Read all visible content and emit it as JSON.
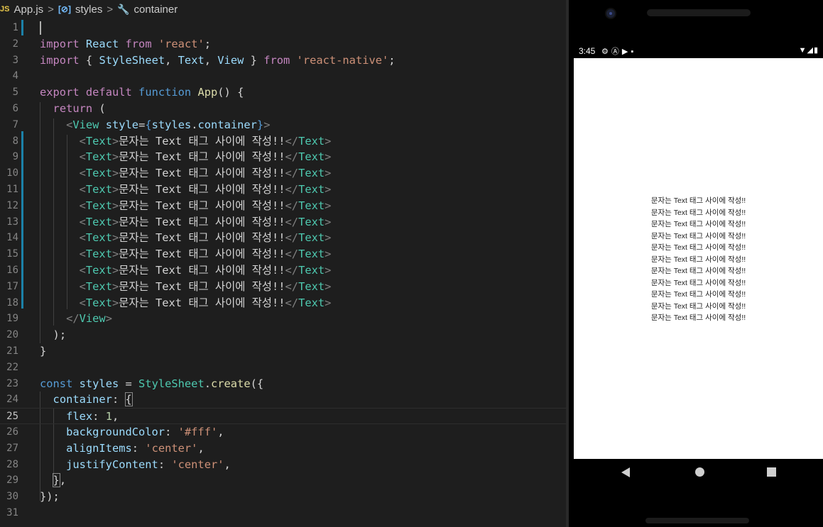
{
  "breadcrumb": {
    "file_icon": "JS",
    "file": "App.js",
    "separator": ">",
    "symbol_icon": "[⊘]",
    "symbol": "styles",
    "member_icon": "wrench-icon",
    "member": "container"
  },
  "editor": {
    "line_numbers": [
      "1",
      "2",
      "3",
      "4",
      "5",
      "6",
      "7",
      "8",
      "9",
      "10",
      "11",
      "12",
      "13",
      "14",
      "15",
      "16",
      "17",
      "18",
      "19",
      "20",
      "21",
      "22",
      "23",
      "24",
      "25",
      "26",
      "27",
      "28",
      "29",
      "30",
      "31"
    ],
    "code": {
      "l2": {
        "kw1": "import",
        "id": "React",
        "kw2": "from",
        "str": "'react'",
        "end": ";"
      },
      "l3": {
        "kw1": "import",
        "open": "{ ",
        "a": "StyleSheet",
        "c1": ", ",
        "b": "Text",
        "c2": ", ",
        "c": "View",
        "close": " }",
        "kw2": "from",
        "str": "'react-native'",
        "end": ";"
      },
      "l5": {
        "kw1": "export",
        "kw2": "default",
        "kw3": "function",
        "fn": "App",
        "rest": "() {"
      },
      "l6": {
        "kw": "return",
        "rest": " ("
      },
      "l7": {
        "lt": "<",
        "tag": "View",
        "attr": "style",
        "eq": "=",
        "ob": "{",
        "obj": "styles",
        "dot": ".",
        "prop": "container",
        "cb": "}",
        "gt": ">"
      },
      "text_line": {
        "open_lt": "<",
        "open_tag": "Text",
        "open_gt": ">",
        "content": "문자는 Text 태그 사이에 작성!!",
        "close_lt": "</",
        "close_tag": "Text",
        "close_gt": ">"
      },
      "l19": {
        "lt": "</",
        "tag": "View",
        "gt": ">"
      },
      "l20": {
        "text": ");"
      },
      "l21": {
        "text": "}"
      },
      "l23": {
        "kw": "const",
        "id": "styles",
        "eq": " = ",
        "cls": "StyleSheet",
        "dot": ".",
        "fn": "create",
        "rest": "({"
      },
      "l24": {
        "prop": "container",
        "colon": ": ",
        "brace": "{"
      },
      "l25": {
        "prop": "flex",
        "colon": ": ",
        "num": "1",
        "end": ","
      },
      "l26": {
        "prop": "backgroundColor",
        "colon": ": ",
        "str": "'#fff'",
        "end": ","
      },
      "l27": {
        "prop": "alignItems",
        "colon": ": ",
        "str": "'center'",
        "end": ","
      },
      "l28": {
        "prop": "justifyContent",
        "colon": ": ",
        "str": "'center'",
        "end": ","
      },
      "l29": {
        "brace": "}",
        "end": ","
      },
      "l30": {
        "text": "});"
      }
    }
  },
  "emulator": {
    "status_time": "3:45",
    "status_icons": [
      "gear-icon",
      "a-icon",
      "play-icon",
      "sd-card-icon"
    ],
    "status_right_icons": [
      "wifi-icon",
      "signal-icon",
      "battery-icon"
    ],
    "rendered_texts": [
      "문자는 Text 태그 사이에 작성!!",
      "문자는 Text 태그 사이에 작성!!",
      "문자는 Text 태그 사이에 작성!!",
      "문자는 Text 태그 사이에 작성!!",
      "문자는 Text 태그 사이에 작성!!",
      "문자는 Text 태그 사이에 작성!!",
      "문자는 Text 태그 사이에 작성!!",
      "문자는 Text 태그 사이에 작성!!",
      "문자는 Text 태그 사이에 작성!!",
      "문자는 Text 태그 사이에 작성!!",
      "문자는 Text 태그 사이에 작성!!"
    ],
    "nav_buttons": [
      "back-icon",
      "home-icon",
      "recents-icon"
    ]
  }
}
